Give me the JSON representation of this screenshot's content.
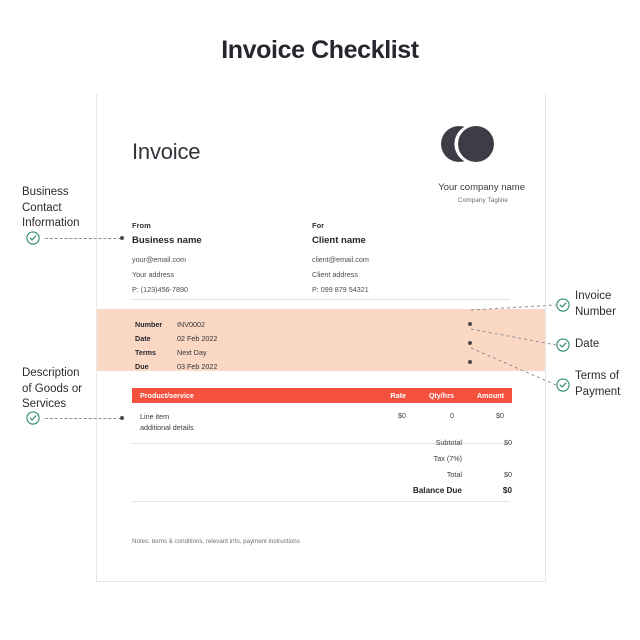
{
  "page": {
    "title": "Invoice Checklist",
    "background": "#ffffff"
  },
  "colors": {
    "orange_bar": "#f6631c",
    "peach_band": "#fbd8c3",
    "table_header": "#f4523f",
    "check_green": "#2e8b6f",
    "text_dark": "#26262e"
  },
  "invoice": {
    "heading": "Invoice",
    "logo": "two-overlapping-circles-logo",
    "company_name": "Your company name",
    "company_tagline": "Company Tagline",
    "from": {
      "heading": "From",
      "name": "Business name",
      "email": "your@email.com",
      "address": "Your address",
      "phone": "P: (123)456-7890"
    },
    "to": {
      "heading": "For",
      "name": "Client name",
      "email": "client@email.com",
      "address": "Client address",
      "phone": "P: 099 879 54321"
    },
    "details": [
      {
        "label": "Number",
        "value": "INV0002"
      },
      {
        "label": "Date",
        "value": "02 Feb 2022"
      },
      {
        "label": "Terms",
        "value": "Next Day"
      },
      {
        "label": "Due",
        "value": "03 Feb 2022"
      }
    ],
    "table": {
      "columns": [
        "Product/service",
        "Rate",
        "Qty/hrs",
        "Amount"
      ],
      "rows": [
        {
          "description": "Line item",
          "sub_description": "additional details",
          "rate": "$0",
          "qty": "0",
          "amount": "$0"
        }
      ]
    },
    "totals": [
      {
        "label": "Subtotal",
        "value": "$0"
      },
      {
        "label": "Tax (7%)",
        "value": ""
      },
      {
        "label": "Total",
        "value": "$0"
      },
      {
        "label": "Balance Due",
        "value": "$0"
      }
    ],
    "notes": "Notes: terms & conditions, relevant info, payment instructions"
  },
  "annotations": {
    "left": [
      {
        "id": "business-contact-information",
        "label": "Business\nContact\nInformation",
        "icon": "check-circle-icon"
      },
      {
        "id": "description-of-goods-or-services",
        "label": "Description\nof Goods or\nServices",
        "icon": "check-circle-icon"
      }
    ],
    "right": [
      {
        "id": "invoice-number",
        "label": "Invoice\nNumber",
        "icon": "check-circle-icon"
      },
      {
        "id": "date",
        "label": "Date",
        "icon": "check-circle-icon"
      },
      {
        "id": "terms-of-payment",
        "label": "Terms of\nPayment",
        "icon": "check-circle-icon"
      }
    ]
  }
}
